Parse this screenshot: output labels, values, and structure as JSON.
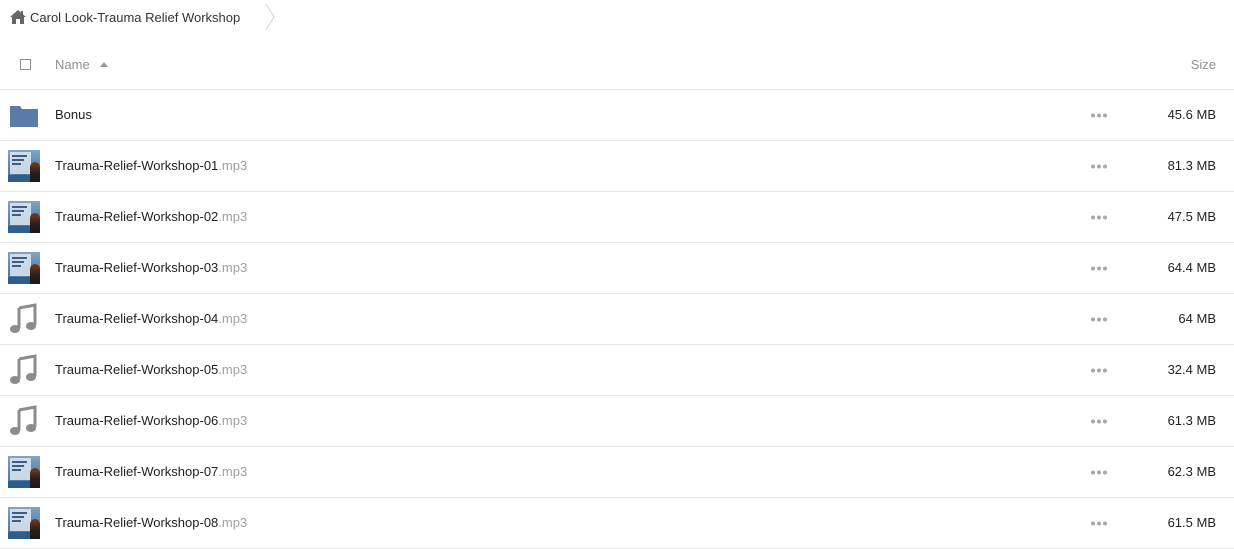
{
  "breadcrumb": {
    "home_icon": "home-icon",
    "current": "Carol Look-Trauma Relief Workshop"
  },
  "header": {
    "name_label": "Name",
    "size_label": "Size",
    "sort_icon": "sort-ascending-icon"
  },
  "colors": {
    "folder": "#5b7aa6",
    "music_icon": "#8c8c8c",
    "extension_text": "#a0a0a0",
    "row_border": "#e6e6e6"
  },
  "files": [
    {
      "icon": "folder-icon",
      "name": "Bonus",
      "ext": "",
      "size": "45.6 MB"
    },
    {
      "icon": "thumbnail",
      "name": "Trauma-Relief-Workshop-01",
      "ext": ".mp3",
      "size": "81.3 MB"
    },
    {
      "icon": "thumbnail",
      "name": "Trauma-Relief-Workshop-02",
      "ext": ".mp3",
      "size": "47.5 MB"
    },
    {
      "icon": "thumbnail",
      "name": "Trauma-Relief-Workshop-03",
      "ext": ".mp3",
      "size": "64.4 MB"
    },
    {
      "icon": "music-note-icon",
      "name": "Trauma-Relief-Workshop-04",
      "ext": ".mp3",
      "size": "64 MB"
    },
    {
      "icon": "music-note-icon",
      "name": "Trauma-Relief-Workshop-05",
      "ext": ".mp3",
      "size": "32.4 MB"
    },
    {
      "icon": "music-note-icon",
      "name": "Trauma-Relief-Workshop-06",
      "ext": ".mp3",
      "size": "61.3 MB"
    },
    {
      "icon": "thumbnail",
      "name": "Trauma-Relief-Workshop-07",
      "ext": ".mp3",
      "size": "62.3 MB"
    },
    {
      "icon": "thumbnail",
      "name": "Trauma-Relief-Workshop-08",
      "ext": ".mp3",
      "size": "61.5 MB"
    }
  ]
}
